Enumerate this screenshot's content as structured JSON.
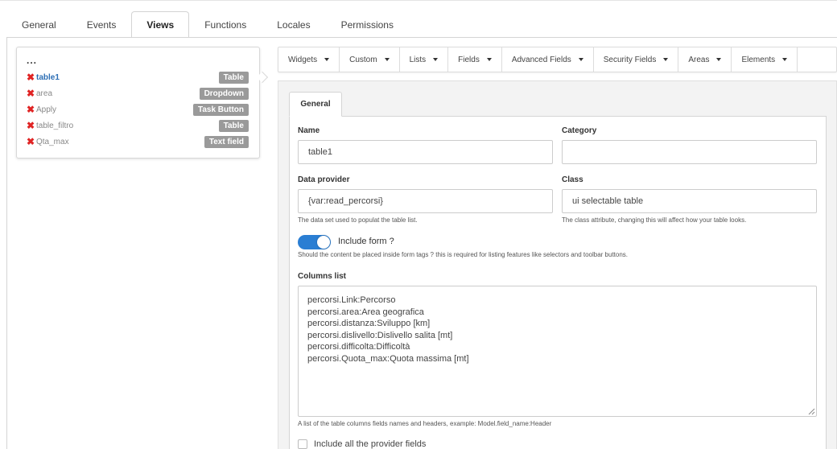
{
  "main_tabs": [
    "General",
    "Events",
    "Views",
    "Functions",
    "Locales",
    "Permissions"
  ],
  "active_tab": "Views",
  "widget_list": {
    "header": "...",
    "items": [
      {
        "name": "table1",
        "type": "Table",
        "selected": true
      },
      {
        "name": "area",
        "type": "Dropdown",
        "selected": false
      },
      {
        "name": "Apply",
        "type": "Task Button",
        "selected": false
      },
      {
        "name": "table_filtro",
        "type": "Table",
        "selected": false
      },
      {
        "name": "Qta_max",
        "type": "Text field",
        "selected": false
      }
    ],
    "delete_glyph": "✖"
  },
  "toolbar_menu": [
    "Widgets",
    "Custom",
    "Lists",
    "Fields",
    "Advanced Fields",
    "Security Fields",
    "Areas",
    "Elements"
  ],
  "form": {
    "tab": "General",
    "name_label": "Name",
    "name_value": "table1",
    "category_label": "Category",
    "category_value": "",
    "data_provider_label": "Data provider",
    "data_provider_value": "{var:read_percorsi}",
    "data_provider_help": "The data set used to populat the table list.",
    "class_label": "Class",
    "class_value": "ui selectable table",
    "class_help": "The class attribute, changing this will affect how your table looks.",
    "include_form_label": "Include form ?",
    "include_form_on": true,
    "include_form_help": "Should the content be placed inside form tags ? this is required for listing features like selectors and toolbar buttons.",
    "columns_label": "Columns list",
    "columns_value": "percorsi.Link:Percorso\npercorsi.area:Area geografica\npercorsi.distanza:Sviluppo [km]\npercorsi.dislivello:Dislivello salita [mt]\npercorsi.difficolta:Difficoltà\npercorsi.Quota_max:Quota massima [mt]",
    "columns_help": "A list of the table columns fields names and headers, example: Model.field_name:Header",
    "include_all_label": "Include all the provider fields",
    "include_all_checked": false
  },
  "colors": {
    "accent": "#2a7ed3",
    "delete": "#e02424",
    "badge": "#9a9a9a",
    "selected_item": "#2c6eb5"
  }
}
